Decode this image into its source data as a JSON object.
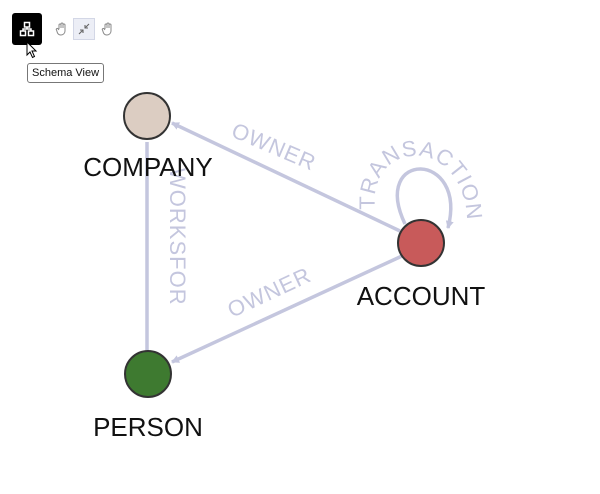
{
  "toolbar": {
    "schema_view_icon": "schema-icon",
    "pan_icon": "hand-icon",
    "fit_icon": "collapse-arrows-icon",
    "hand_icon": "hand-icon",
    "tooltip": "Schema View"
  },
  "graph": {
    "nodes": [
      {
        "id": "company",
        "label": "COMPANY",
        "color": "#dccdc2"
      },
      {
        "id": "account",
        "label": "ACCOUNT",
        "color": "#c85a5a"
      },
      {
        "id": "person",
        "label": "PERSON",
        "color": "#3e7a30"
      }
    ],
    "edges": [
      {
        "id": "owner-company",
        "label": "OWNER"
      },
      {
        "id": "owner-person",
        "label": "OWNER"
      },
      {
        "id": "worksfor",
        "label": "WORKSFOR"
      },
      {
        "id": "transaction",
        "label": "TRANSACTION"
      }
    ],
    "edge_color": "#c4c6de"
  }
}
